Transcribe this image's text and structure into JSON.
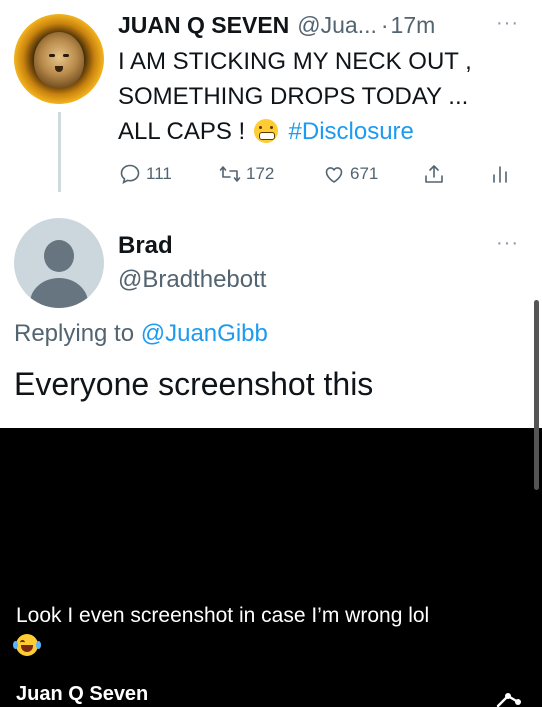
{
  "original_tweet": {
    "name": "JUAN Q SEVEN",
    "handle": "@Jua...",
    "separator": "·",
    "time": "17m",
    "more": "···",
    "lines": [
      "I AM STICKING MY NECK OUT ,",
      "SOMETHING DROPS TODAY ...",
      "ALL CAPS !"
    ],
    "hashtag": "#Disclosure",
    "replies": "111",
    "retweets": "172",
    "likes": "671"
  },
  "reply": {
    "name": "Brad",
    "handle": "@Bradthebott",
    "more": "···",
    "replying_prefix": "Replying to",
    "replying_to": "@JuanGibb",
    "text": "Everyone screenshot this"
  },
  "caption": {
    "text": "Look I even screenshot in case I’m wrong lol",
    "author": "Juan Q Seven"
  },
  "icons": [
    "reply-icon",
    "retweet-icon",
    "like-icon",
    "share-icon",
    "analytics-icon",
    "grimacing-emoji",
    "joy-emoji"
  ],
  "colors": {
    "link": "#1d9bf0",
    "muted": "#536471",
    "text": "#0f1419",
    "background_lower": "#000000"
  }
}
